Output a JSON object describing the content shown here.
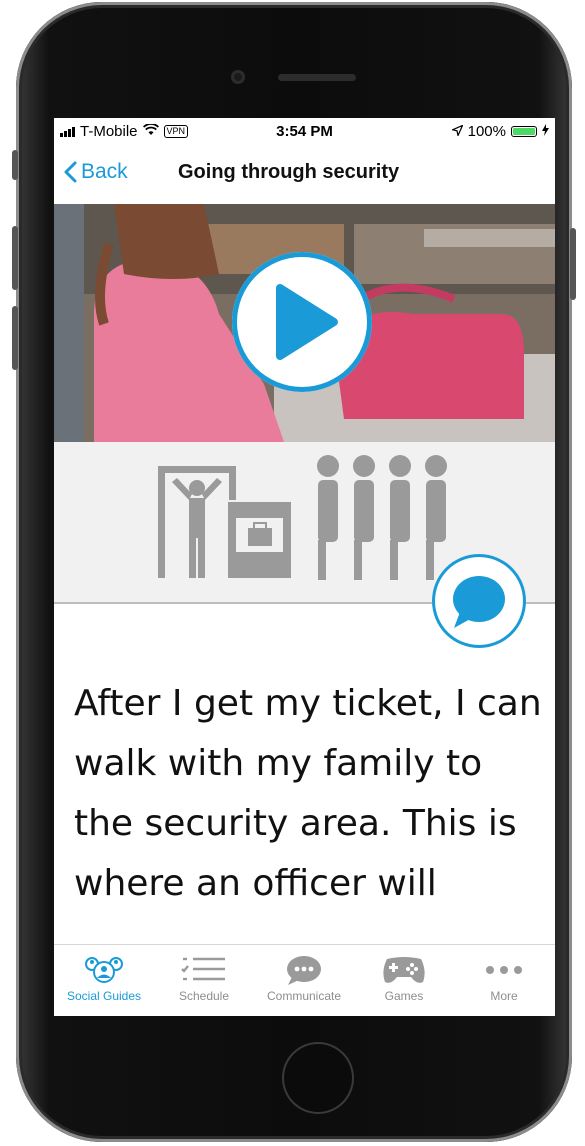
{
  "status_bar": {
    "carrier": "T-Mobile",
    "vpn": "VPN",
    "time": "3:54 PM",
    "battery": "100%"
  },
  "nav": {
    "back_label": "Back",
    "title": "Going through security"
  },
  "story_text": "After I get my ticket, I can walk with my family to the security area. This is where an officer will",
  "tabs": [
    {
      "label": "Social Guides",
      "icon": "social-guides-icon",
      "active": true
    },
    {
      "label": "Schedule",
      "icon": "schedule-icon",
      "active": false
    },
    {
      "label": "Communicate",
      "icon": "communicate-icon",
      "active": false
    },
    {
      "label": "Games",
      "icon": "games-icon",
      "active": false
    },
    {
      "label": "More",
      "icon": "more-icon",
      "active": false
    }
  ],
  "colors": {
    "accent": "#1a9bd7",
    "illustration": "#9a9a9a",
    "battery": "#4cd964"
  }
}
